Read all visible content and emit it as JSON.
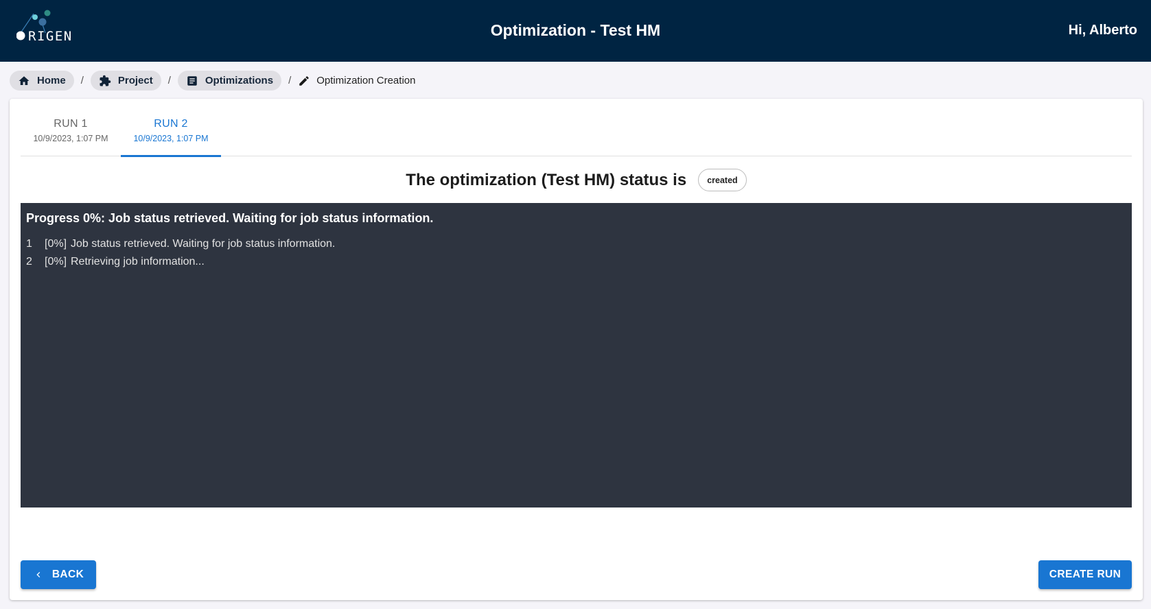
{
  "header": {
    "logo_text": "ORIGEN",
    "title": "Optimization - Test HM",
    "greeting": "Hi, Alberto"
  },
  "breadcrumb": {
    "items": [
      {
        "label": "Home",
        "icon": "home-icon"
      },
      {
        "label": "Project",
        "icon": "puzzle-icon"
      },
      {
        "label": "Optimizations",
        "icon": "document-icon"
      }
    ],
    "separator": "/",
    "current": {
      "label": "Optimization Creation",
      "icon": "pencil-icon"
    }
  },
  "tabs": [
    {
      "label": "RUN 1",
      "date": "10/9/2023, 1:07 PM",
      "active": false
    },
    {
      "label": "RUN 2",
      "date": "10/9/2023, 1:07 PM",
      "active": true
    }
  ],
  "status": {
    "text": "The optimization (Test HM) status is",
    "badge": "created"
  },
  "console": {
    "heading": "Progress 0%: Job status retrieved. Waiting for job status information.",
    "progress_percent": 0,
    "lines": [
      {
        "n": "1",
        "pct": "[0%]",
        "msg": "Job status retrieved. Waiting for job status information."
      },
      {
        "n": "2",
        "pct": "[0%]",
        "msg": "Retrieving job information..."
      }
    ]
  },
  "actions": {
    "back_label": "BACK",
    "create_label": "CREATE RUN"
  },
  "colors": {
    "header_bg": "#002442",
    "accent": "#1976d2",
    "console_bg": "#2e3440"
  }
}
